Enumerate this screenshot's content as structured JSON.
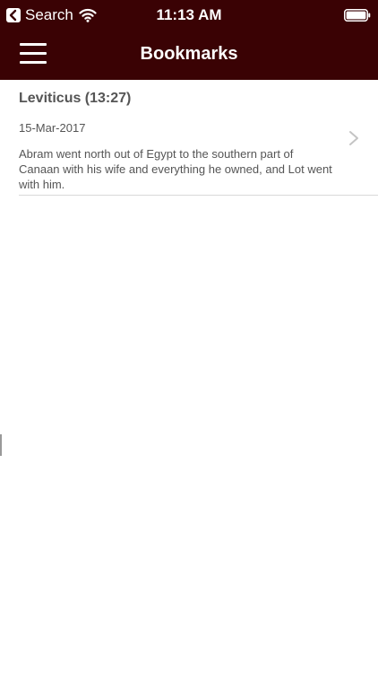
{
  "status_bar": {
    "back_label": "Search",
    "time": "11:13 AM"
  },
  "nav_bar": {
    "title": "Bookmarks"
  },
  "bookmarks": [
    {
      "title": "Leviticus (13:27)",
      "date": "15-Mar-2017",
      "text": "Abram went north out of Egypt to the southern part of Canaan with his wife and everything he owned, and Lot went with him."
    }
  ],
  "colors": {
    "header_background": "#3a0204",
    "text": "#555555",
    "separator": "#d9d9d9"
  },
  "icons": [
    "back-arrow-icon",
    "wifi-icon",
    "battery-icon",
    "hamburger-menu-icon",
    "chevron-right-icon"
  ]
}
